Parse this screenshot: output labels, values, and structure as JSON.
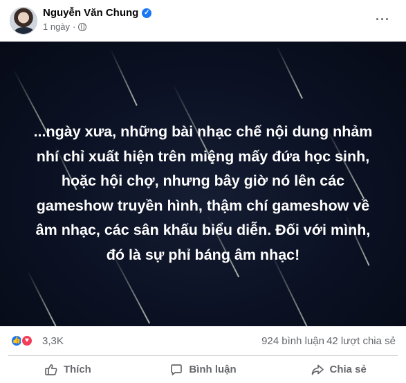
{
  "post": {
    "author": "Nguyễn Văn Chung",
    "verified_icon": "verified-badge-icon",
    "time": "1 ngày",
    "audience_icon": "globe-icon",
    "more_icon": "more-options-icon",
    "more_label": "···",
    "text": "...ngày xưa, những bài nhạc chế nội dung nhảm\nnhí chỉ xuất hiện trên miệng mấy đứa học sinh,\nhoặc hội chợ, nhưng bây giờ nó lên các\ngameshow truyền hình, thậm chí gameshow về\nâm nhạc, các sân khấu biểu diễn. Đối với mình,\nđó là sự phỉ báng âm nhạc!"
  },
  "stats": {
    "reactions": [
      "like-icon",
      "love-icon"
    ],
    "reaction_count": "3,3K",
    "comments": "924 bình luận",
    "shares": "42 lượt chia sẻ"
  },
  "actions": {
    "like": "Thích",
    "comment": "Bình luận",
    "share": "Chia sẻ"
  },
  "colors": {
    "accent": "#1877f2",
    "love": "#f33e58",
    "muted": "#65676b",
    "image_bg": "#0b1123"
  }
}
